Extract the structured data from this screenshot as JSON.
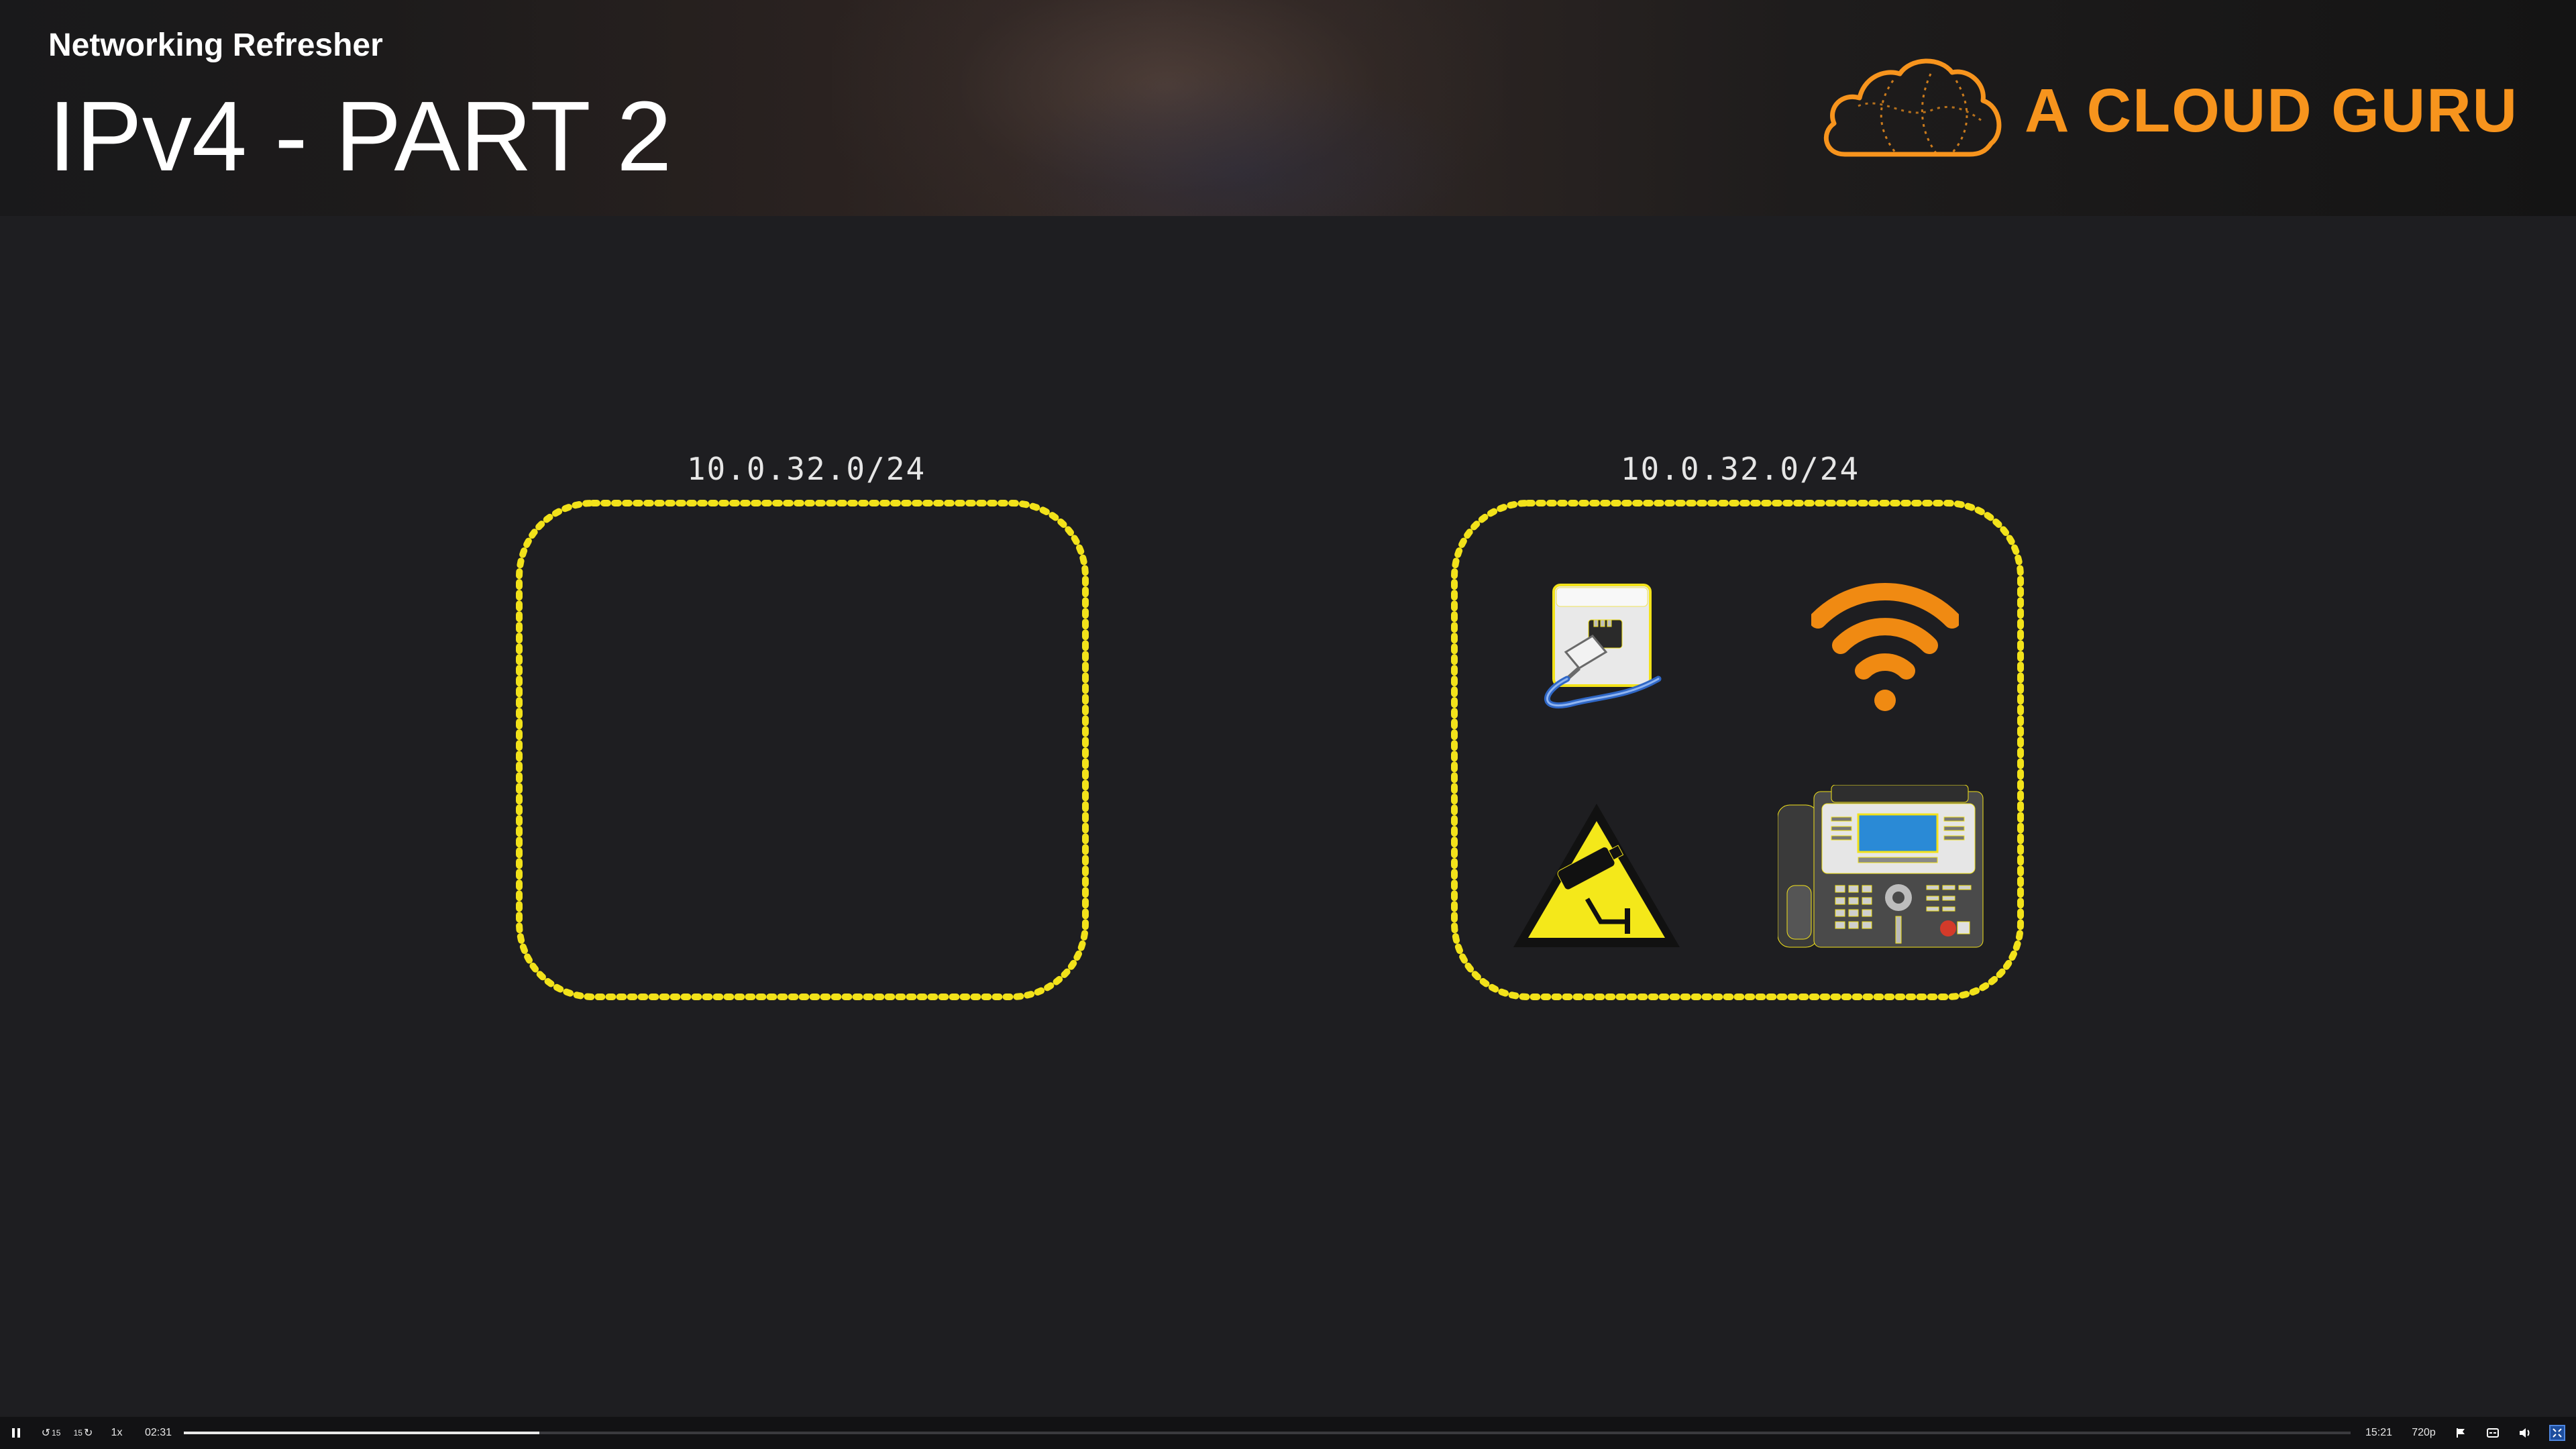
{
  "header": {
    "course_title": "Networking Refresher",
    "lesson_title": "IPv4 - PART 2",
    "brand_name": "A CLOUD GURU",
    "brand_icon": "cloud-logo-icon",
    "brand_color": "#f7941d"
  },
  "diagram": {
    "outline_color": "#f2e21a",
    "subnets": [
      {
        "label": "10.0.32.0/24",
        "devices": []
      },
      {
        "label": "10.0.32.0/24",
        "devices": [
          {
            "icon": "ethernet-port-icon",
            "kind": "wired network jack"
          },
          {
            "icon": "wifi-icon",
            "kind": "wireless"
          },
          {
            "icon": "security-camera-icon",
            "kind": "CCTV warning sign"
          },
          {
            "icon": "ip-phone-icon",
            "kind": "desk phone"
          }
        ]
      }
    ]
  },
  "player": {
    "play_pause_icon": "pause-icon",
    "rewind_label": "15",
    "forward_label": "15",
    "speed_label": "1x",
    "current_time": "02:31",
    "duration": "15:21",
    "quality_label": "720p",
    "progress": 0.164,
    "icons": [
      "flag-icon",
      "captions-icon",
      "volume-icon",
      "fullscreen-icon"
    ]
  }
}
